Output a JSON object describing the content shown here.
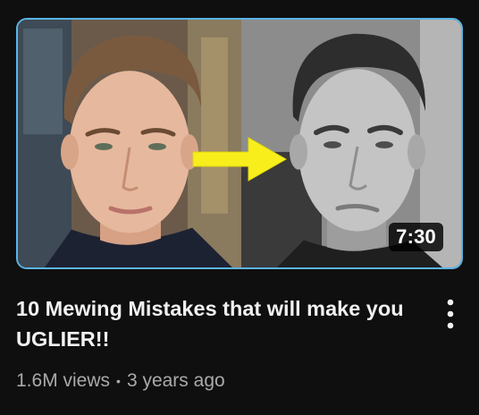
{
  "video": {
    "title": "10 Mewing Mistakes that will make you UGLIER!!",
    "duration": "7:30",
    "views": "1.6M views",
    "separator": "•",
    "age": "3 years ago"
  },
  "thumbnail": {
    "border_color": "#5ab4e6",
    "arrow_color": "#f7ee1c",
    "left_panel": "color",
    "right_panel": "black-and-white"
  },
  "icons": {
    "more_actions": "vertical-ellipsis-icon",
    "arrow": "arrow-right-icon"
  }
}
